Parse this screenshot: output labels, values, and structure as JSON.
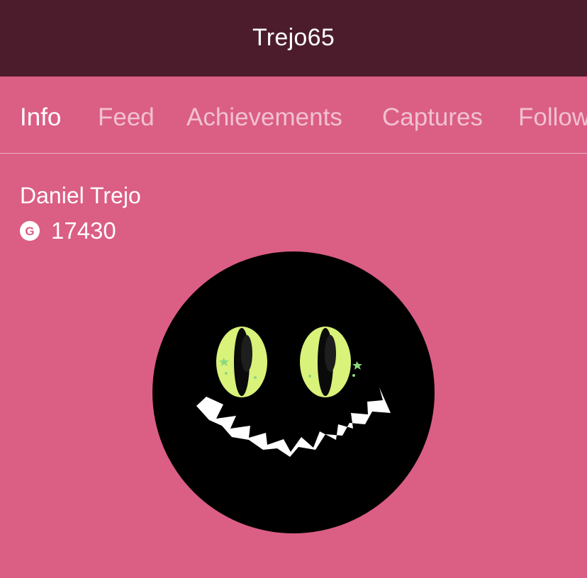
{
  "header": {
    "title": "Trejo65"
  },
  "tabs": [
    {
      "label": "Info",
      "active": true
    },
    {
      "label": "Feed",
      "active": false
    },
    {
      "label": "Achievements",
      "active": false
    },
    {
      "label": "Captures",
      "active": false
    },
    {
      "label": "Followers",
      "active": false
    }
  ],
  "profile": {
    "real_name": "Daniel Trejo",
    "gamerscore_icon_letter": "G",
    "gamerscore": "17430",
    "avatar_icon": "grinning-cat-face"
  },
  "colors": {
    "title_bar": "#4C1C2D",
    "background": "#DB5E85",
    "avatar_bg": "#000000",
    "eye": "#D8F27A"
  }
}
